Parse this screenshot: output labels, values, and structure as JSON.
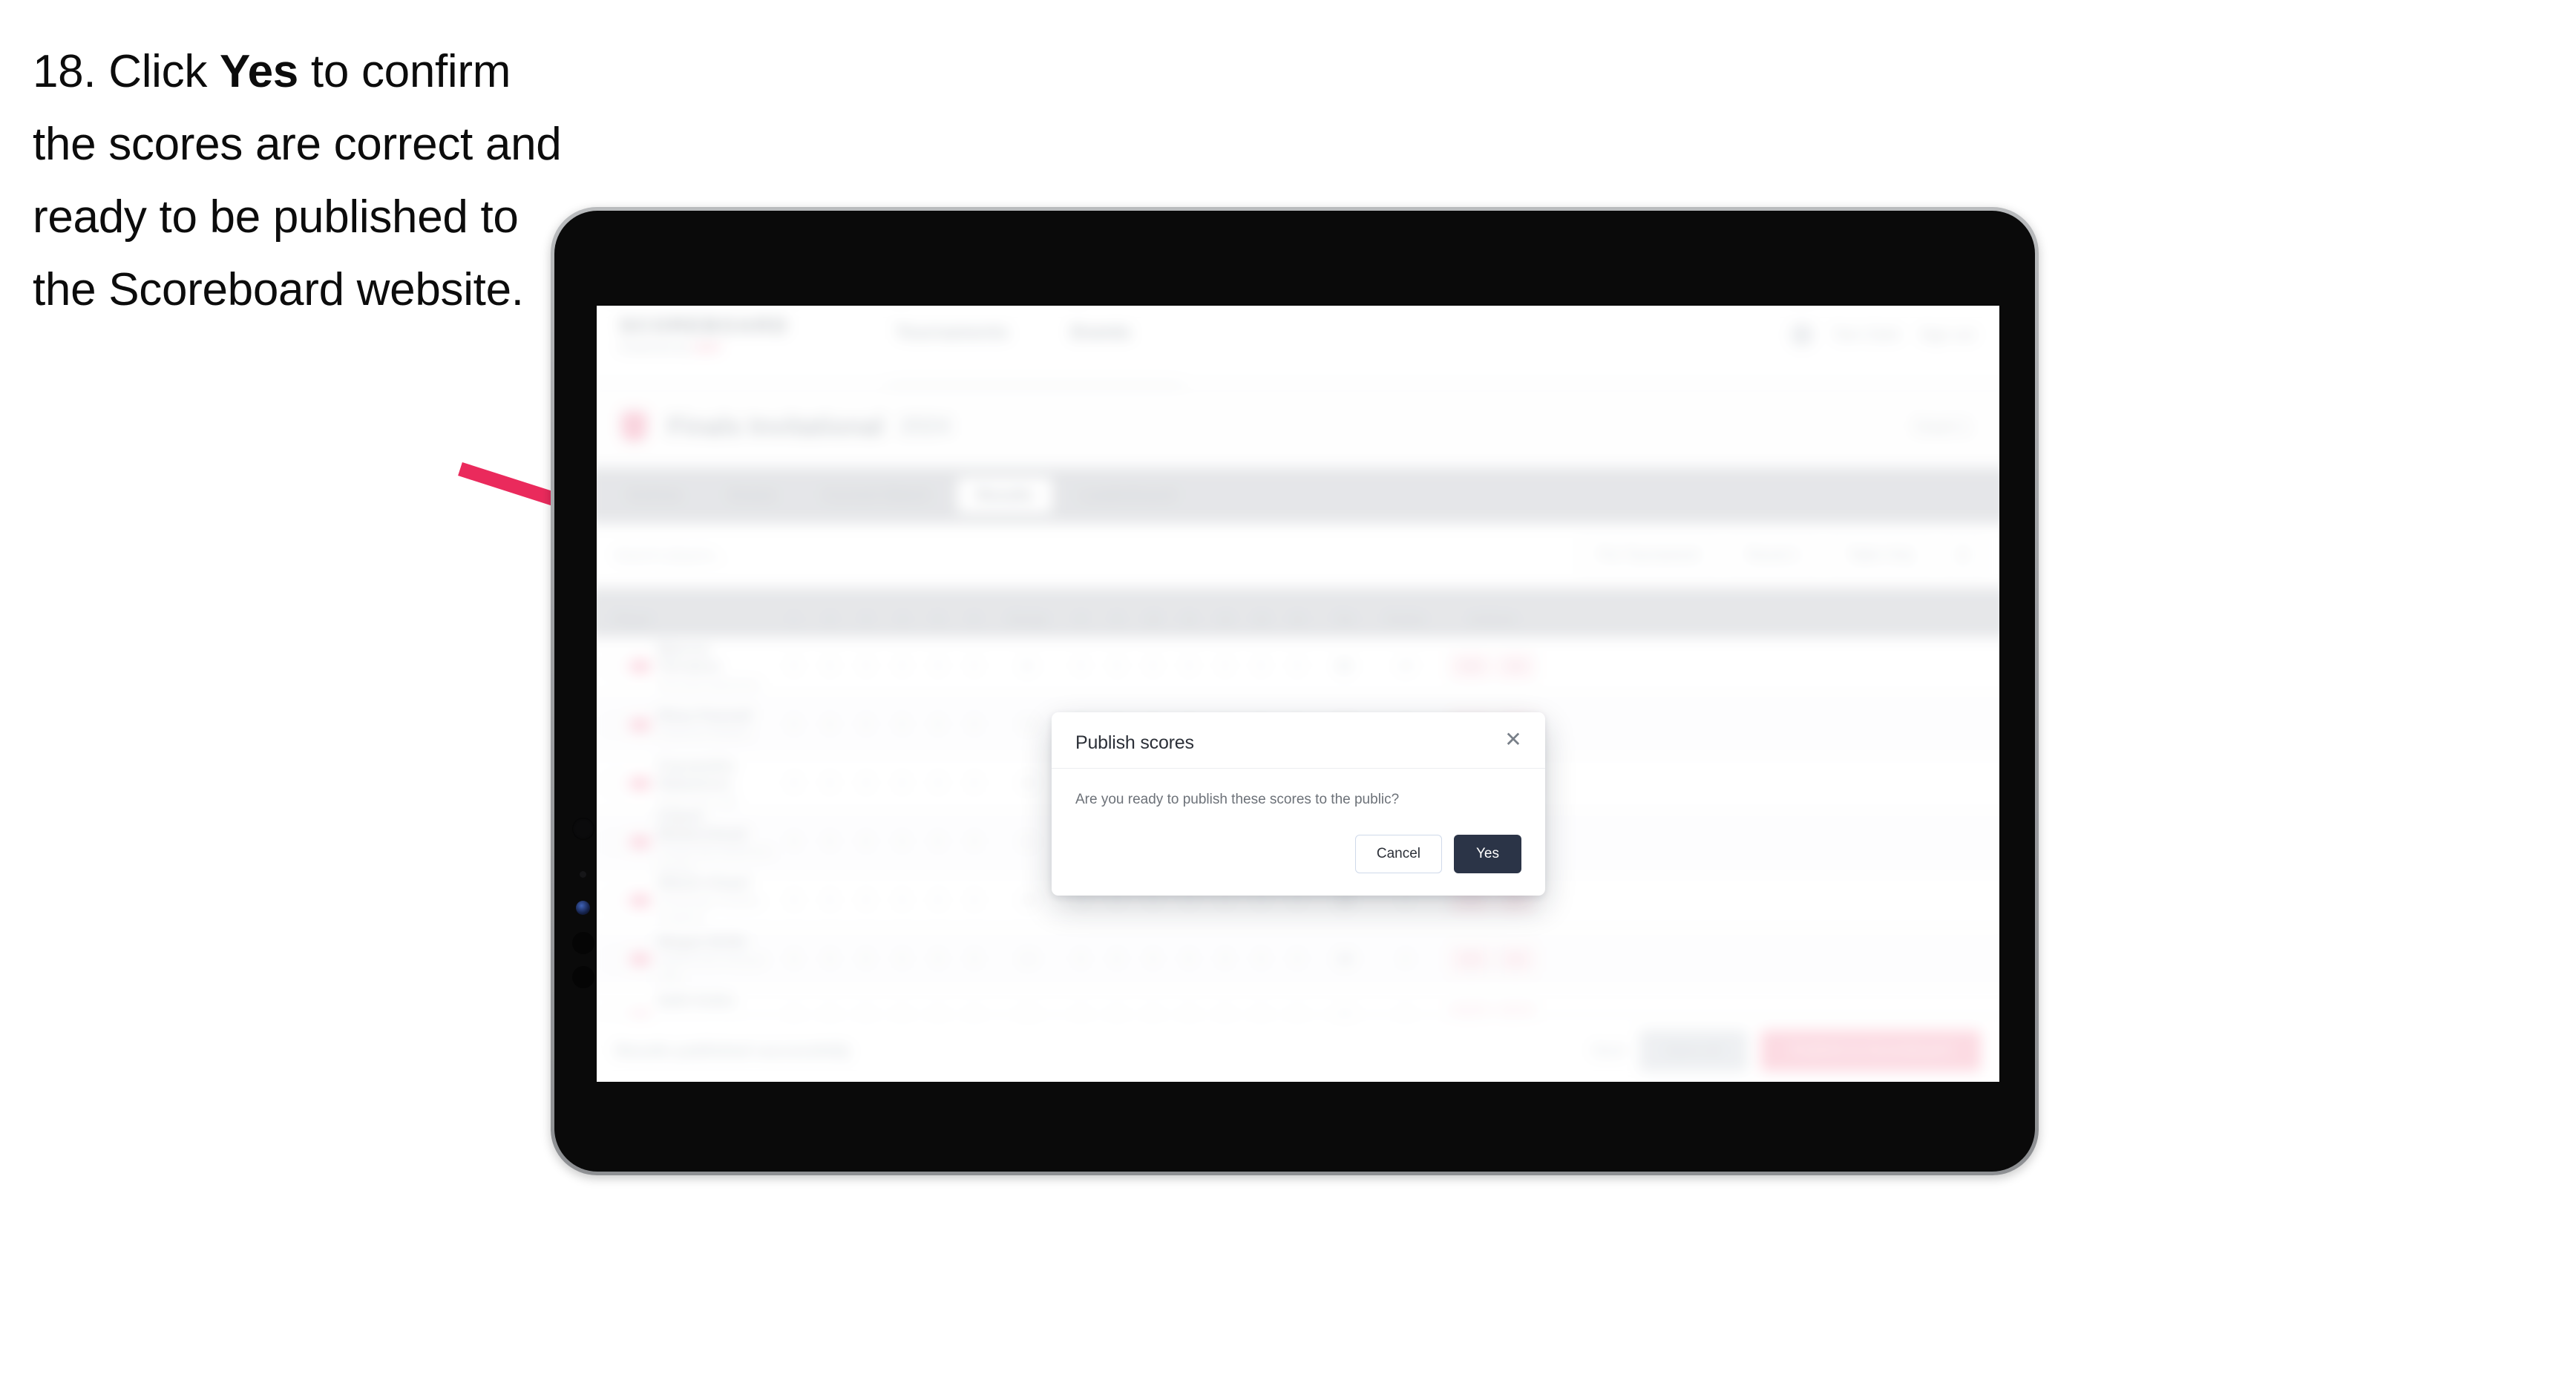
{
  "caption": {
    "step_number": "18.",
    "text_before": "Click ",
    "emphasis": "Yes",
    "text_after": " to confirm the scores are correct and ready to be published to the Scoreboard website."
  },
  "annotation": {
    "arrow_color": "#EA2A5C",
    "arrow_name": "pointer-arrow"
  },
  "device": {
    "type": "tablet",
    "frame_color": "#a4a6a9",
    "screen_color": "#0a0a0a"
  },
  "app": {
    "brand": {
      "name": "SCOREBOARD",
      "subtitle_left": "Powered by",
      "subtitle_mark": "BWF"
    },
    "topnav": [
      {
        "label": "Tournaments"
      },
      {
        "label": "Events"
      }
    ],
    "header_right": {
      "user": "Tom Clerk",
      "signout": "Sign out"
    },
    "event": {
      "title": "Finals Invitational",
      "tag": "2024",
      "right_label": "Court 1"
    },
    "tabs": [
      {
        "label": "Entries",
        "selected": false
      },
      {
        "label": "Draws",
        "selected": false
      },
      {
        "label": "Current Match",
        "selected": false
      },
      {
        "label": "Results",
        "selected": true
      },
      {
        "label": "Leaderboard",
        "selected": false
      }
    ],
    "filters": {
      "search_placeholder": "Search players...",
      "buttons": [
        {
          "label": "Pre-Tournament"
        },
        {
          "label": "Round 1"
        },
        {
          "label": "Table Only"
        }
      ],
      "icon_button": "filter-icon"
    },
    "table": {
      "columns": [
        {
          "key": "player",
          "label": "Player"
        },
        {
          "key": "c1",
          "label": "1"
        },
        {
          "key": "c2",
          "label": "2"
        },
        {
          "key": "c3",
          "label": "3"
        },
        {
          "key": "c4",
          "label": "4"
        },
        {
          "key": "c5",
          "label": "5"
        },
        {
          "key": "c6",
          "label": "6"
        },
        {
          "key": "c7",
          "label": "Group"
        },
        {
          "key": "c8",
          "label": "8"
        },
        {
          "key": "c9",
          "label": "9"
        },
        {
          "key": "c10",
          "label": "10"
        },
        {
          "key": "c11",
          "label": "11"
        },
        {
          "key": "c12",
          "label": "12"
        },
        {
          "key": "c13",
          "label": "13"
        },
        {
          "key": "c14",
          "label": "14"
        },
        {
          "key": "total",
          "label": "Tot"
        },
        {
          "key": "points",
          "label": "Points"
        },
        {
          "key": "actions",
          "label": "Actions"
        }
      ],
      "rows": [
        {
          "name": "Marcus Torrance",
          "club": "Riverside Badminton",
          "scores": [
            "0",
            "0",
            "0",
            "0",
            "0",
            "0",
            "21",
            "0",
            "0",
            "0",
            "0",
            "0",
            "0",
            "0"
          ],
          "total": "21",
          "points": "10",
          "actions": [
            "Edit",
            "Del"
          ]
        },
        {
          "name": "Rhea Pannell",
          "club": "Eastwood Athletics",
          "scores": [
            "0",
            "0",
            "0",
            "0",
            "0",
            "0",
            "18",
            "0",
            "0",
            "0",
            "0",
            "0",
            "0",
            "0"
          ],
          "total": "18",
          "points": "8",
          "actions": [
            "Edit",
            "Del"
          ]
        },
        {
          "name": "Cassandra Nakamura",
          "club": "North Park Club",
          "scores": [
            "0",
            "0",
            "0",
            "0",
            "0",
            "0",
            "16",
            "0",
            "0",
            "0",
            "0",
            "0",
            "0",
            "0"
          ],
          "total": "16",
          "points": "7",
          "actions": [
            "Edit",
            "Del"
          ]
        },
        {
          "name": "Calum Mottershead",
          "club": "Granite Bay Badminton Society",
          "scores": [
            "0",
            "0",
            "0",
            "0",
            "0",
            "0",
            "21",
            "0",
            "0",
            "0",
            "0",
            "0",
            "0",
            "0"
          ],
          "total": "21",
          "points": "6",
          "actions": [
            "Edit",
            "Del"
          ]
        },
        {
          "name": "Nilesh Khatri",
          "club": "Westbridge Shuttlers Academy",
          "scores": [
            "0",
            "0",
            "0",
            "0",
            "0",
            "0",
            "19",
            "0",
            "0",
            "0",
            "0",
            "0",
            "0",
            "0"
          ],
          "total": "19",
          "points": "5",
          "actions": [
            "Edit",
            "Del"
          ]
        },
        {
          "name": "Megan Brille",
          "club": "Harbourview Racquet Club",
          "scores": [
            "0",
            "0",
            "0",
            "0",
            "0",
            "0",
            "14",
            "0",
            "0",
            "0",
            "0",
            "0",
            "0",
            "0"
          ],
          "total": "14",
          "points": "4",
          "actions": [
            "Edit",
            "Del"
          ]
        },
        {
          "name": "Seth Kolev",
          "club": "Lakeside Smash Community",
          "scores": [
            "0",
            "0",
            "0",
            "0",
            "0",
            "0",
            "12",
            "0",
            "0",
            "0",
            "0",
            "0",
            "0",
            "0"
          ],
          "total": "12",
          "points": "3",
          "actions": [
            "Edit",
            "Del"
          ]
        }
      ]
    },
    "footer": {
      "note": "Results published successfully",
      "link": "Back",
      "save_label": "Save all",
      "publish_label": "Publish to Scoreboard"
    }
  },
  "modal": {
    "title": "Publish scores",
    "close_icon": "close-icon",
    "message": "Are you ready to publish these scores to the public?",
    "cancel_label": "Cancel",
    "confirm_label": "Yes",
    "confirm_color": "#2b3447"
  }
}
